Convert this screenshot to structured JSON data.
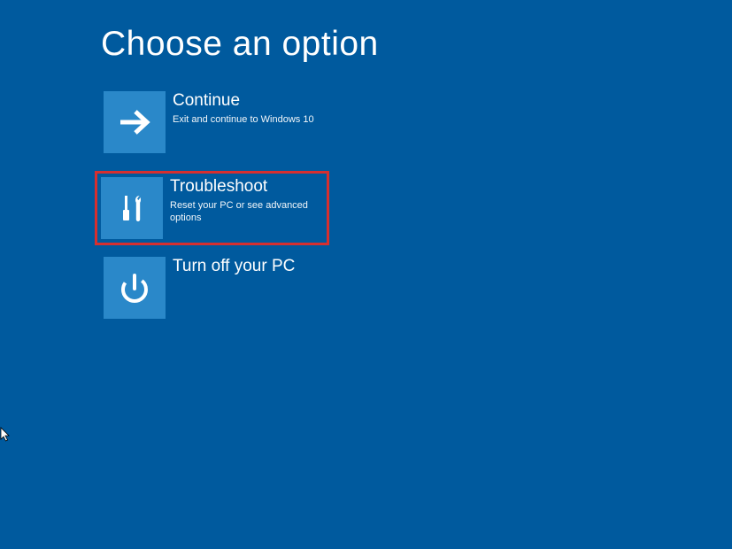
{
  "page": {
    "title": "Choose an option"
  },
  "options": {
    "continue": {
      "title": "Continue",
      "desc": "Exit and continue to Windows 10"
    },
    "troubleshoot": {
      "title": "Troubleshoot",
      "desc": "Reset your PC or see advanced options"
    },
    "turnoff": {
      "title": "Turn off your PC",
      "desc": ""
    }
  },
  "colors": {
    "background": "#005a9e",
    "tile": "#2a88c9",
    "highlight": "#d62f2f"
  }
}
